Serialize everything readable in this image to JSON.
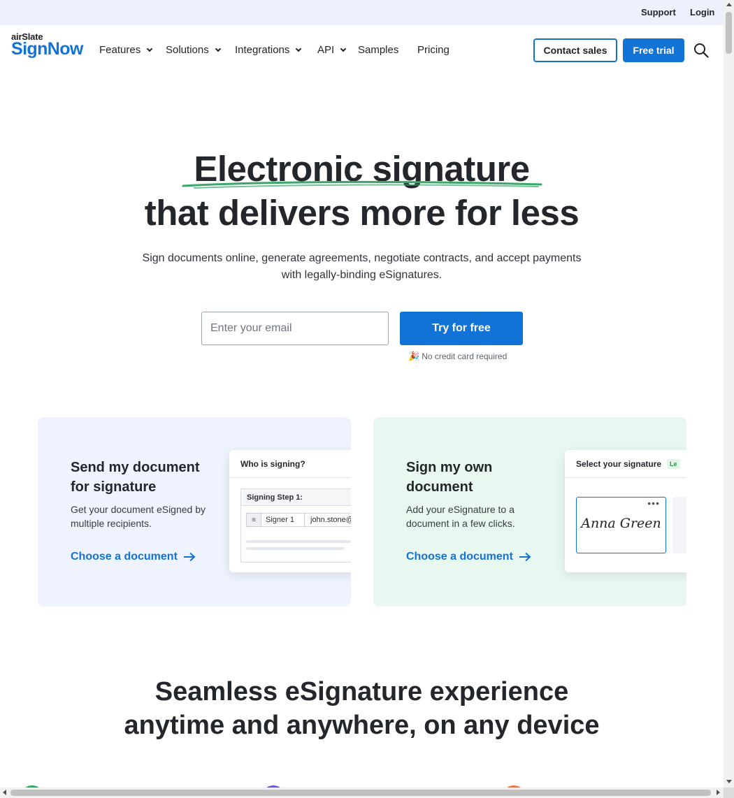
{
  "utility_bar": {
    "support": "Support",
    "login": "Login"
  },
  "logo": {
    "small": "airSlate",
    "big": "SignNow"
  },
  "nav": {
    "items": [
      {
        "label": "Features",
        "has_dropdown": true
      },
      {
        "label": "Solutions",
        "has_dropdown": true
      },
      {
        "label": "Integrations",
        "has_dropdown": true
      },
      {
        "label": "API",
        "has_dropdown": true
      },
      {
        "label": "Samples",
        "has_dropdown": false
      },
      {
        "label": "Pricing",
        "has_dropdown": false
      }
    ],
    "contact_sales": "Contact sales",
    "free_trial": "Free trial"
  },
  "hero": {
    "title_line1": "Electronic signature",
    "title_line2": "that delivers more for less",
    "subtitle_line1": "Sign documents online, generate agreements, negotiate contracts, and accept payments",
    "subtitle_line2": "with legally-binding eSignatures.",
    "email_placeholder": "Enter your email",
    "cta": "Try for free",
    "note_emoji": "🎉",
    "note": "No credit card required"
  },
  "cards": [
    {
      "title": "Send my document for signature",
      "description": "Get your document eSigned by multiple recipients.",
      "link": "Choose a document",
      "mock": {
        "header": "Who is signing?",
        "step_label": "Signing Step 1:",
        "signer": "Signer 1",
        "email": "john.stone@"
      }
    },
    {
      "title": "Sign my own document",
      "description": "Add your eSignature to a document in a few clicks.",
      "link": "Choose a document",
      "mock": {
        "header": "Select your signature",
        "badge": "Le",
        "signature": "Anna Green",
        "dots": "•••"
      }
    }
  ],
  "section2": {
    "title_line1": "Seamless eSignature experience",
    "title_line2": "anytime and anywhere, on any device"
  },
  "colors": {
    "brand_blue": "#1273d6",
    "util_bar_bg": "#eef1fb",
    "card_blue_bg": "#eef3fd",
    "card_green_bg": "#e8f8f0",
    "underline_green": "#3aa66a"
  }
}
